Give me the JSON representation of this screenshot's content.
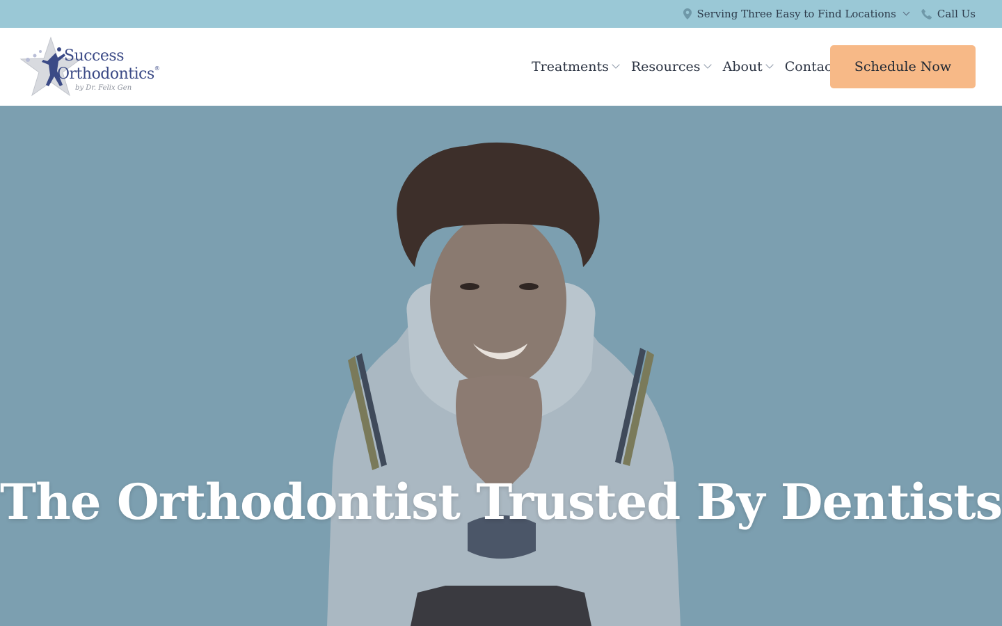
{
  "topbar": {
    "locations_label": "Serving Three Easy to Find Locations",
    "call_label": "Call Us",
    "pin_icon": "map-pin-icon",
    "phone_icon": "phone-icon"
  },
  "logo": {
    "line1": "Success",
    "line2": "Orthodontics",
    "registered": "®",
    "byline": "by Dr. Felix Gen"
  },
  "nav": {
    "items": [
      {
        "label": "Treatments",
        "has_dropdown": true
      },
      {
        "label": "Resources",
        "has_dropdown": true
      },
      {
        "label": "About",
        "has_dropdown": true
      },
      {
        "label": "Contact",
        "has_dropdown": false
      }
    ],
    "cta_label": "Schedule Now"
  },
  "hero": {
    "title": "The Orthodontist Trusted By Dentists"
  },
  "colors": {
    "topbar_bg": "#9ac8d6",
    "hero_bg": "#7c9fb0",
    "cta_bg": "#f7b987",
    "brand_blue": "#3b4a86"
  }
}
